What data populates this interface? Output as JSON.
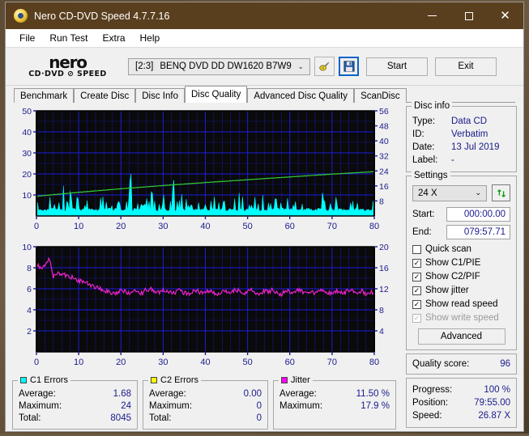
{
  "window": {
    "title": "Nero CD-DVD Speed 4.7.7.16",
    "app_icon": "disc-icon",
    "minimize": "─",
    "maximize": "☐",
    "close": "✕"
  },
  "menu": {
    "items": [
      {
        "label": "File"
      },
      {
        "label": "Run Test"
      },
      {
        "label": "Extra"
      },
      {
        "label": "Help"
      }
    ]
  },
  "toolbar": {
    "logo_top": "nero",
    "logo_bottom": "CD·DVD ⊘ SPEED",
    "drive_id": "[2:3]",
    "drive_name": "BENQ DVD DD DW1620 B7W9",
    "dropdown_arrow": "⌄",
    "eject_icon": "disc-eject-icon",
    "save_icon": "floppy-save-icon",
    "start_label": "Start",
    "exit_label": "Exit"
  },
  "tabs": [
    {
      "label": "Benchmark",
      "active": false
    },
    {
      "label": "Create Disc",
      "active": false
    },
    {
      "label": "Disc Info",
      "active": false
    },
    {
      "label": "Disc Quality",
      "active": true
    },
    {
      "label": "Advanced Disc Quality",
      "active": false
    },
    {
      "label": "ScanDisc",
      "active": false
    }
  ],
  "disc_info": {
    "title": "Disc info",
    "type_label": "Type:",
    "type_value": "Data CD",
    "id_label": "ID:",
    "id_value": "Verbatim",
    "date_label": "Date:",
    "date_value": "13 Jul 2019",
    "label_label": "Label:",
    "label_value": "-"
  },
  "settings": {
    "title": "Settings",
    "speed_value": "24 X",
    "speed_arrow": "⌄",
    "refresh_icon": "refresh-icon",
    "start_label": "Start:",
    "start_value": "000:00.00",
    "end_label": "End:",
    "end_value": "079:57.71",
    "checkboxes": [
      {
        "label": "Quick scan",
        "checked": false,
        "disabled": false
      },
      {
        "label": "Show C1/PIE",
        "checked": true,
        "disabled": false
      },
      {
        "label": "Show C2/PIF",
        "checked": true,
        "disabled": false
      },
      {
        "label": "Show jitter",
        "checked": true,
        "disabled": false
      },
      {
        "label": "Show read speed",
        "checked": true,
        "disabled": false
      },
      {
        "label": "Show write speed",
        "checked": true,
        "disabled": true
      }
    ],
    "advanced_label": "Advanced"
  },
  "quality": {
    "label": "Quality score:",
    "value": "96"
  },
  "progress": {
    "progress_label": "Progress:",
    "progress_value": "100 %",
    "position_label": "Position:",
    "position_value": "79:55.00",
    "speed_label": "Speed:",
    "speed_value": "26.87 X"
  },
  "stats": {
    "c1": {
      "title": "C1 Errors",
      "color": "#00ffff",
      "average_label": "Average:",
      "average_value": "1.68",
      "maximum_label": "Maximum:",
      "maximum_value": "24",
      "total_label": "Total:",
      "total_value": "8045"
    },
    "c2": {
      "title": "C2 Errors",
      "color": "#ffff00",
      "average_label": "Average:",
      "average_value": "0.00",
      "maximum_label": "Maximum:",
      "maximum_value": "0",
      "total_label": "Total:",
      "total_value": "0"
    },
    "jitter": {
      "title": "Jitter",
      "color": "#ff00ff",
      "average_label": "Average:",
      "average_value": "11.50 %",
      "maximum_label": "Maximum:",
      "maximum_value": "17.9 %"
    }
  },
  "chart_data": [
    {
      "type": "area",
      "name": "c1-errors-chart",
      "title": "",
      "xlabel": "",
      "ylabel": "",
      "xlim": [
        0,
        80
      ],
      "ylim": [
        0,
        50
      ],
      "y2lim": [
        0,
        56
      ],
      "xticks": [
        0,
        10,
        20,
        30,
        40,
        50,
        60,
        70,
        80
      ],
      "yticks": [
        10,
        20,
        30,
        40,
        50
      ],
      "y2ticks": [
        8,
        16,
        24,
        32,
        40,
        48,
        56
      ],
      "grid": true,
      "plot_bg": "#0a0a0a",
      "grid_color": "#1c1cdc",
      "series": [
        {
          "name": "C1 Errors",
          "color": "#00ffff",
          "style": "spikes",
          "baseline": 2.2,
          "x": [
            0,
            1,
            2,
            3,
            4,
            5,
            6,
            7,
            8,
            9,
            10,
            11,
            12,
            13,
            14,
            15,
            16,
            17,
            18,
            19,
            20,
            21,
            22,
            23,
            24,
            25,
            26,
            27,
            28,
            29,
            30,
            31,
            32,
            33,
            34,
            35,
            36,
            37,
            38,
            39,
            40,
            41,
            42,
            43,
            44,
            45,
            46,
            47,
            48,
            49,
            50,
            51,
            52,
            53,
            54,
            55,
            56,
            57,
            58,
            59,
            60,
            61,
            62,
            63,
            64,
            65,
            66,
            67,
            68,
            69,
            70,
            71,
            72,
            73,
            74,
            75,
            76,
            77,
            78,
            79,
            80
          ],
          "values": [
            7,
            5,
            9,
            11,
            6,
            8,
            17,
            7,
            12,
            9,
            11,
            6,
            9,
            7,
            5,
            11,
            8,
            6,
            10,
            7,
            13,
            9,
            23,
            10,
            7,
            6,
            9,
            13,
            8,
            6,
            10,
            7,
            17,
            9,
            14,
            8,
            6,
            11,
            7,
            9,
            6,
            8,
            12,
            7,
            9,
            6,
            10,
            7,
            11,
            8,
            6,
            9,
            7,
            12,
            8,
            6,
            10,
            7,
            9,
            11,
            6,
            8,
            7,
            10,
            6,
            9,
            7,
            11,
            8,
            6,
            9,
            7,
            10,
            6,
            8,
            11,
            7,
            9,
            6,
            8,
            5
          ]
        },
        {
          "name": "Read speed",
          "color": "#33cc33",
          "style": "line",
          "axis": "right",
          "x": [
            0,
            10,
            20,
            30,
            40,
            50,
            60,
            70,
            80
          ],
          "values": [
            10.5,
            12.6,
            14.5,
            16.2,
            17.8,
            19.3,
            20.8,
            22.3,
            23.6
          ]
        }
      ]
    },
    {
      "type": "line",
      "name": "jitter-chart",
      "title": "",
      "xlabel": "",
      "ylabel": "",
      "xlim": [
        0,
        80
      ],
      "ylim": [
        0,
        10
      ],
      "y2lim": [
        0,
        20
      ],
      "xticks": [
        0,
        10,
        20,
        30,
        40,
        50,
        60,
        70,
        80
      ],
      "yticks": [
        2,
        4,
        6,
        8,
        10
      ],
      "y2ticks": [
        4,
        8,
        12,
        16,
        20
      ],
      "grid": true,
      "plot_bg": "#0a0a0a",
      "grid_color": "#1c1cdc",
      "series": [
        {
          "name": "Jitter",
          "color": "#ee22cc",
          "style": "line",
          "x": [
            0,
            1,
            2,
            3,
            4,
            5,
            6,
            7,
            8,
            9,
            10,
            11,
            12,
            13,
            14,
            15,
            16,
            17,
            18,
            19,
            20,
            21,
            22,
            23,
            24,
            25,
            26,
            27,
            28,
            29,
            30,
            31,
            32,
            33,
            34,
            35,
            36,
            37,
            38,
            39,
            40,
            41,
            42,
            43,
            44,
            45,
            46,
            47,
            48,
            49,
            50,
            51,
            52,
            53,
            54,
            55,
            56,
            57,
            58,
            59,
            60,
            61,
            62,
            63,
            64,
            65,
            66,
            67,
            68,
            69,
            70,
            71,
            72,
            73,
            74,
            75,
            76,
            77,
            78,
            79,
            80
          ],
          "values": [
            8.4,
            8.0,
            8.2,
            8.9,
            7.2,
            7.5,
            7.4,
            7.3,
            7.2,
            6.9,
            6.8,
            6.7,
            6.5,
            6.3,
            6.1,
            6.0,
            5.9,
            5.7,
            5.5,
            5.6,
            5.8,
            5.7,
            5.6,
            5.8,
            5.7,
            5.6,
            5.9,
            6.0,
            5.8,
            5.6,
            5.9,
            5.8,
            5.6,
            5.7,
            5.9,
            5.6,
            5.5,
            5.8,
            5.9,
            5.6,
            5.7,
            5.9,
            5.6,
            5.5,
            5.8,
            5.7,
            5.6,
            5.9,
            5.8,
            5.6,
            5.7,
            5.9,
            5.6,
            5.5,
            5.8,
            5.7,
            5.9,
            5.6,
            5.5,
            5.8,
            5.7,
            5.6,
            5.9,
            5.7,
            5.5,
            5.8,
            5.6,
            5.7,
            5.9,
            5.6,
            5.5,
            5.8,
            5.7,
            5.6,
            5.9,
            5.7,
            5.6,
            5.8,
            5.5,
            5.7,
            5.6
          ]
        }
      ]
    }
  ]
}
